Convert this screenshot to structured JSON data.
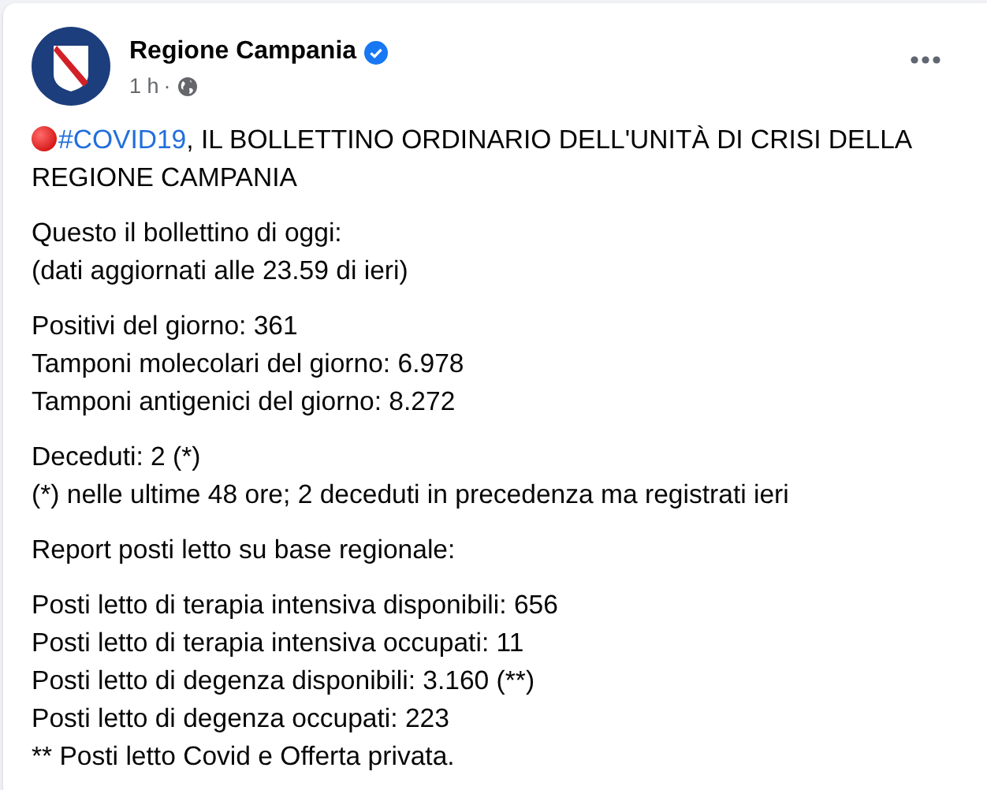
{
  "post": {
    "author": "Regione Campania",
    "verified": true,
    "time": "1 h",
    "separator": "·",
    "headline": {
      "emoji": true,
      "hashtag": "#COVID19",
      "text": ", IL BOLLETTINO ORDINARIO DELL'UNITÀ DI CRISI DELLA REGIONE CAMPANIA"
    },
    "paragraphs": [
      {
        "lines": [
          "Questo il bollettino di oggi:",
          "(dati aggiornati alle 23.59 di ieri)"
        ]
      },
      {
        "lines": [
          "Positivi del giorno: 361",
          "Tamponi molecolari del giorno: 6.978",
          "Tamponi antigenici del giorno: 8.272"
        ]
      },
      {
        "lines": [
          "Deceduti: 2 (*)",
          "(*) nelle ultime 48 ore; 2 deceduti in precedenza ma registrati ieri"
        ]
      },
      {
        "lines": [
          "Report posti letto su base regionale:"
        ]
      },
      {
        "lines": [
          "Posti letto di terapia intensiva disponibili: 656",
          "Posti letto di terapia intensiva occupati: 11",
          "Posti letto di degenza disponibili: 3.160 (**)",
          "Posti letto di degenza occupati: 223",
          "** Posti letto Covid e Offerta privata."
        ]
      }
    ]
  }
}
